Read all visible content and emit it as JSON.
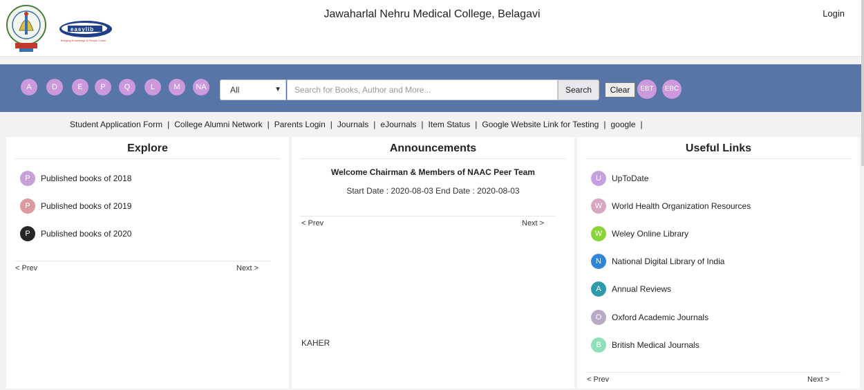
{
  "header": {
    "brand": "easylib",
    "brand_tagline": "Bringing Knowledge & People Closer",
    "title": "Jawaharlal Nehru Medical College, Belagavi",
    "login_label": "Login"
  },
  "search": {
    "alphabet": [
      "A",
      "D",
      "E",
      "P",
      "Q",
      "L",
      "M",
      "NA"
    ],
    "category_selected": "All",
    "placeholder": "Search for Books, Author and More...",
    "search_label": "Search",
    "clear_label": "Clear",
    "extra_buttons": [
      "EBT",
      "EBC"
    ],
    "accent_color": "#5875a7",
    "pill_color": "#cc99dd"
  },
  "quick_links": [
    "Student Application Form",
    "College Alumni Network",
    "Parents Login",
    "Journals",
    "eJournals",
    "Item Status",
    "Google Website Link for Testing",
    "google"
  ],
  "explore": {
    "title": "Explore",
    "items": [
      {
        "letter": "P",
        "label": "Published books of 2018",
        "color": "#c7a0d8"
      },
      {
        "letter": "P",
        "label": "Published books of 2019",
        "color": "#d99b9b"
      },
      {
        "letter": "P",
        "label": "Published books of 2020",
        "color": "#262626"
      }
    ],
    "prev_label": "< Prev",
    "next_label": "Next >"
  },
  "announcements": {
    "title": "Announcements",
    "heading": "Welcome Chairman & Members of NAAC Peer Team",
    "dates": "Start Date : 2020-08-03 End Date : 2020-08-03",
    "prev_label": "< Prev",
    "next_label": "Next >",
    "footer": "KAHER"
  },
  "useful_links": {
    "title": "Useful Links",
    "items": [
      {
        "letter": "U",
        "label": "UpToDate",
        "color": "#c7a0e0"
      },
      {
        "letter": "W",
        "label": "World Health Organization Resources",
        "color": "#d6a6c2"
      },
      {
        "letter": "W",
        "label": "Weley Online Library",
        "color": "#8ad43a"
      },
      {
        "letter": "N",
        "label": "National Digital Library of India",
        "color": "#2f86d6"
      },
      {
        "letter": "A",
        "label": "Annual Reviews",
        "color": "#2f9aa8"
      },
      {
        "letter": "O",
        "label": "Oxford Academic Journals",
        "color": "#b9a9c6"
      },
      {
        "letter": "B",
        "label": "British Medical Journals",
        "color": "#8fe0b8"
      }
    ],
    "prev_label": "< Prev",
    "next_label": "Next >"
  }
}
